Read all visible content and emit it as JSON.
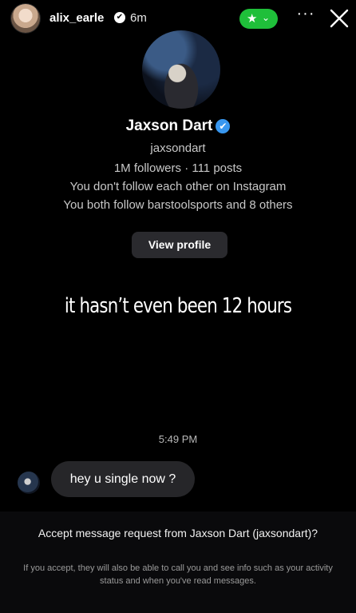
{
  "story": {
    "username": "alix_earle",
    "verified_mark": "✔",
    "time": "6m",
    "close_friends_star": "★",
    "close_friends_chevron": "⌄",
    "more": "···"
  },
  "profile": {
    "name": "Jaxson Dart",
    "verified_mark": "✔",
    "handle": "jaxsondart",
    "stats": "1M followers · 111 posts",
    "follow_status": "You don't follow each other on Instagram",
    "mutuals": "You both follow barstoolsports and 8 others",
    "view_profile_label": "View profile"
  },
  "overlay_caption": "it hasn’t even been 12 hours",
  "chat": {
    "timestamp": "5:49 PM",
    "message": "hey u single now ?"
  },
  "request": {
    "title": "Accept message request from Jaxson Dart (jaxsondart)?",
    "info": "If you accept, they will also be able to call you and see info such as your activity status and when you've read messages."
  },
  "colors": {
    "background": "#000000",
    "close_friends_green": "#1fbf3a",
    "verified_blue": "#3897f0",
    "bubble": "#262629"
  },
  "icons": [
    "close-icon",
    "more-icon",
    "star-icon",
    "chevron-down-icon",
    "verified-badge-icon"
  ]
}
